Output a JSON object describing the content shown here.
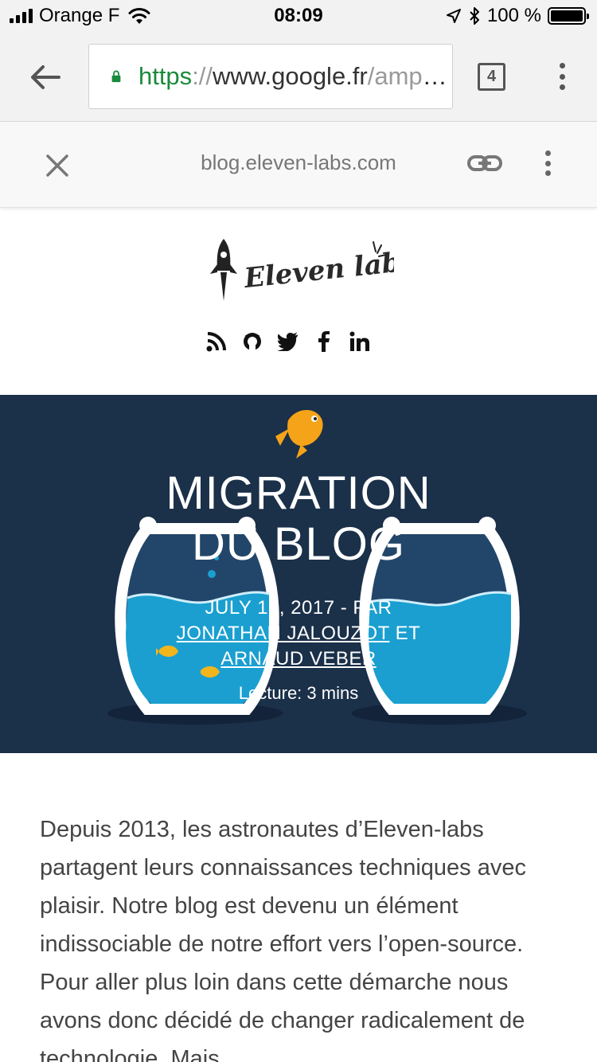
{
  "status_bar": {
    "carrier": "Orange F",
    "time": "08:09",
    "battery_percent": "100 %",
    "battery_level": 1.0,
    "icons": [
      "signal-icon",
      "wifi-icon",
      "location-icon",
      "bluetooth-icon",
      "battery-icon"
    ]
  },
  "browser": {
    "url_scheme": "https",
    "url_sep": "://",
    "url_host": "www.google.fr",
    "url_path": "/amp/blog.eleven-labs.com",
    "tab_count": "4",
    "colors": {
      "secure": "#1a8a3c",
      "toolbar": "#f2f2f2"
    }
  },
  "amp_viewer": {
    "domain": "blog.eleven-labs.com"
  },
  "site": {
    "logo_text": "Eleven labs",
    "social_icons": [
      "rss-icon",
      "github-icon",
      "twitter-icon",
      "facebook-icon",
      "linkedin-icon"
    ]
  },
  "hero": {
    "title_line1": "MIGRATION",
    "title_line2": "DU BLOG",
    "date_prefix": "JULY 13, 2017 - PAR",
    "author1": "JONATHAN JALOUZOT",
    "conj": "ET",
    "author2": "ARNAUD VEBER",
    "reading_time": "Lecture: 3 mins",
    "colors": {
      "background": "#1b3049",
      "water": "#1a9fd0"
    }
  },
  "article": {
    "intro": "Depuis 2013, les astronautes d’Eleven-labs partagent leurs connaissances techniques avec plaisir. Notre blog est devenu un élément indissociable de notre effort vers l’open-source. Pour aller plus loin dans cette démarche nous avons donc décidé de changer radicalement de technologie. Mais"
  }
}
